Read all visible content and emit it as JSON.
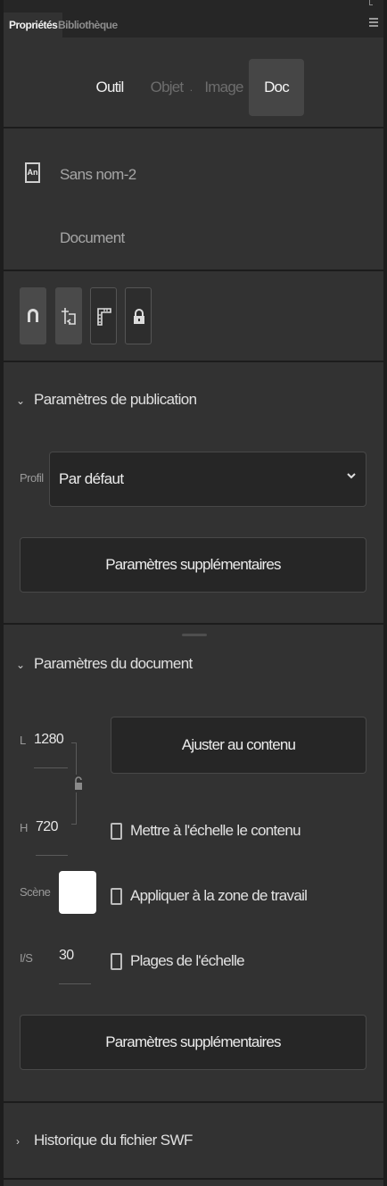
{
  "tabs": {
    "active": "Propriétés",
    "inactive": "Bibliothèque"
  },
  "mode_tabs": {
    "outil": "Outil",
    "objet": "Objet",
    "separator": ".",
    "image": "Image",
    "doc": "Doc"
  },
  "document": {
    "icon_label": "An",
    "name": "Sans nom-2",
    "type": "Document"
  },
  "toolbar": {
    "icons": [
      "magnet-icon",
      "snap-guides-icon",
      "ruler-icon",
      "lock-icon"
    ]
  },
  "publish": {
    "title": "Paramètres de publication",
    "profile_label": "Profil",
    "profile_value": "Par défaut",
    "more_button": "Paramètres supplémentaires"
  },
  "doc_settings": {
    "title": "Paramètres du document",
    "width_label": "L",
    "width_value": "1280",
    "height_label": "H",
    "height_value": "720",
    "fit_button": "Ajuster au contenu",
    "scale_content": "Mettre à l'échelle le contenu",
    "apply_workspace": "Appliquer à la zone de travail",
    "scale_ranges": "Plages de l'échelle",
    "stage_label": "Scène",
    "stage_color": "#FFFFFF",
    "fps_label": "I/S",
    "fps_value": "30",
    "more_button": "Paramètres supplémentaires"
  },
  "history": {
    "title": "Historique du fichier SWF"
  },
  "colors": {
    "panel_bg": "#323232",
    "field_bg": "#262626",
    "selected_tab_bg": "#464646"
  }
}
